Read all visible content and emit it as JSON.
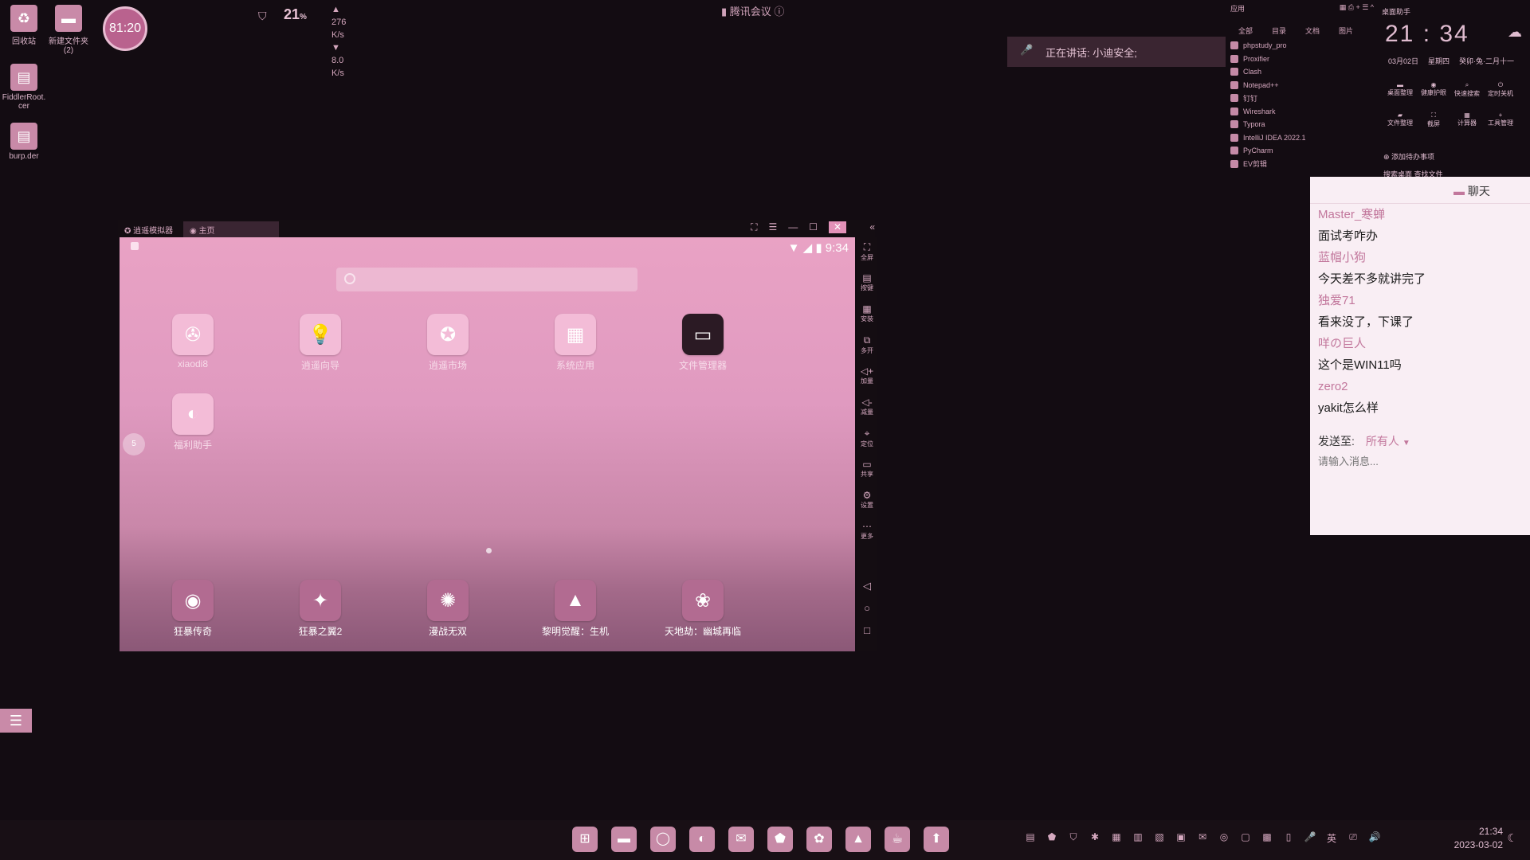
{
  "desktop": {
    "icons": [
      {
        "label": "回收站",
        "glyph": "♻"
      },
      {
        "label": "新建文件夹\n(2)",
        "glyph": "▬"
      },
      {
        "label": "FiddlerRoot.\ncer",
        "glyph": "▤"
      },
      {
        "label": "burp.der",
        "glyph": "▤"
      }
    ],
    "timer": "81:20"
  },
  "net_widget": {
    "cpu": "21",
    "cpu_unit": "%",
    "up": "276 K/s",
    "down": "8.0 K/s"
  },
  "meeting": {
    "title": "腾讯会议",
    "speaking": "正在讲话: 小迪安全;"
  },
  "app_list": {
    "header_left": "应用",
    "tabs": [
      "全部",
      "目录",
      "文档",
      "图片"
    ],
    "items": [
      "phpstudy_pro",
      "Proxifier",
      "Clash",
      "Notepad++",
      "钉钉",
      "Wireshark",
      "Typora",
      "IntelliJ IDEA 2022.1",
      "PyCharm",
      "EV剪辑"
    ]
  },
  "clock_widget": {
    "label": "桌面助手",
    "time": "21 : 34",
    "date": "03月02日",
    "weekday": "星期四",
    "lunar": "癸卯·兔·二月十一",
    "tools": [
      "桌面整理",
      "健康护眼",
      "快速搜索",
      "定时关机",
      "文件整理",
      "截屏",
      "计算器",
      "工具管理"
    ],
    "add_todo": "添加待办事项",
    "footer": "搜索桌面  查找文件"
  },
  "chat": {
    "title": "聊天",
    "messages": [
      {
        "name": "Master_寒蝉",
        "text": "面试考咋办"
      },
      {
        "name": "蓝帽小狗",
        "text": "今天差不多就讲完了"
      },
      {
        "name": "独爱71",
        "text": "看来没了，下课了"
      },
      {
        "name": "咩の巨人",
        "text": "这个是WIN11吗"
      },
      {
        "name": "zero2",
        "text": "yakit怎么样"
      }
    ],
    "send_to_label": "发送至:",
    "send_to_value": "所有人",
    "input_placeholder": "请输入消息..."
  },
  "emulator": {
    "app_tab": "逍遥模拟器",
    "home_tab": "主页",
    "status_time": "9:34",
    "side_tools": [
      "全屏",
      "按键",
      "安装",
      "多开",
      "加量",
      "减量",
      "定位",
      "共享",
      "设置",
      "更多"
    ],
    "apps": [
      {
        "label": "xiaodi8",
        "glyph": "✇"
      },
      {
        "label": "逍遥向导",
        "glyph": "💡"
      },
      {
        "label": "逍遥市场",
        "glyph": "✪"
      },
      {
        "label": "系统应用",
        "glyph": "▦"
      },
      {
        "label": "文件管理器",
        "glyph": "▭"
      },
      {
        "label": "福利助手",
        "glyph": "◐"
      }
    ],
    "dock": [
      {
        "label": "狂暴传奇",
        "glyph": "◉"
      },
      {
        "label": "狂暴之翼2",
        "glyph": "✦"
      },
      {
        "label": "漫战无双",
        "glyph": "✺"
      },
      {
        "label": "黎明觉醒：生机",
        "glyph": "▲"
      },
      {
        "label": "天地劫：幽城再临",
        "glyph": "❀"
      }
    ],
    "side_ball": "5"
  },
  "taskbar": {
    "apps": [
      "⊞",
      "▬",
      "◯",
      "◐",
      "✉",
      "⬟",
      "✿",
      "▲",
      "☕",
      "⬆"
    ],
    "tray": [
      "▤",
      "⬟",
      "⛉",
      "✱",
      "▦",
      "▥",
      "▧",
      "▣",
      "✉",
      "◎",
      "▢",
      "▩",
      "▯",
      "🎤",
      "英",
      "⎚",
      "🔊"
    ],
    "time": "21:34",
    "date": "2023-03-02"
  }
}
